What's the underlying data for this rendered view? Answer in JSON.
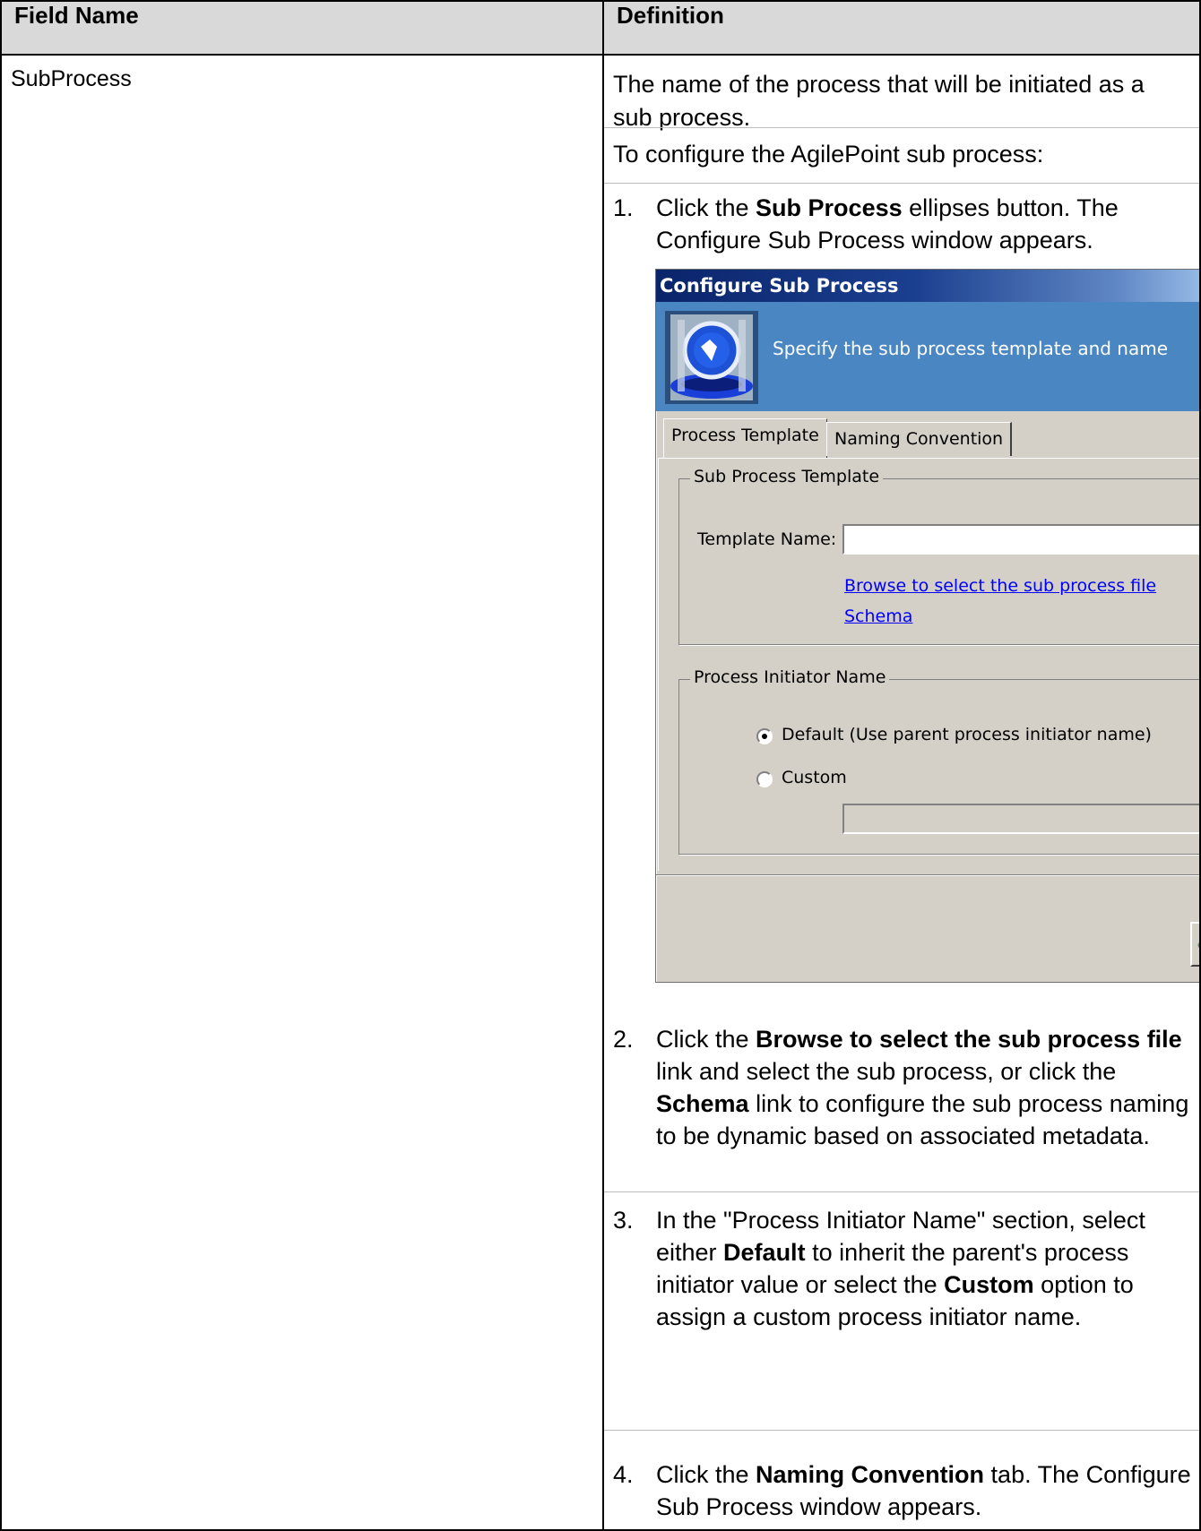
{
  "table": {
    "header_field": "Field Name",
    "header_definition": "Definition",
    "field_name": "SubProcess",
    "definition_intro": "The name of the process that will be initiated as a sub process.",
    "configure_intro": "To configure the AgilePoint sub process:"
  },
  "steps": {
    "s1": {
      "num": "1.",
      "pre": "Click the ",
      "bold": "Sub Process",
      "post": " ellipses button. The Configure Sub Process window appears."
    },
    "s2": {
      "num": "2.",
      "pre": "Click the ",
      "bold1": "Browse to select the sub process file",
      "mid1": " link and select the sub process, or click the ",
      "bold2": "Schema",
      "post": " link to configure the sub process naming to be dynamic based on associated metadata."
    },
    "s3": {
      "num": "3.",
      "pre": "In the \"Process Initiator Name\" section, select either ",
      "bold1": "Default",
      "mid1": " to inherit the parent's process initiator value or select the ",
      "bold2": "Custom",
      "post": " option to assign a custom process initiator name."
    },
    "s4": {
      "num": "4.",
      "pre": "Click the ",
      "bold": "Naming Convention",
      "post": " tab. The Configure Sub Process window appears."
    }
  },
  "dialog": {
    "title": "Configure Sub Process",
    "header_text": "Specify the sub process template and name",
    "tabs": [
      "Process Template",
      "Naming Convention"
    ],
    "group1_label": "Sub Process Template",
    "template_name_label": "Template Name:",
    "template_name_value": "",
    "browse_link": "Browse to select the sub process file",
    "schema_link": "Schema",
    "group2_label": "Process Initiator Name",
    "radio_default": "Default (Use parent process initiator name)",
    "radio_custom": "Custom",
    "custom_value": ""
  },
  "colors": {
    "title_bar": "#0a246a",
    "header_bg": "#4a87c2",
    "dialog_bg": "#d4d0c8",
    "link": "#0000ff",
    "table_header": "#d9d9d9"
  },
  "icons": {
    "header": "process-gears-icon",
    "ok": "check-icon"
  }
}
